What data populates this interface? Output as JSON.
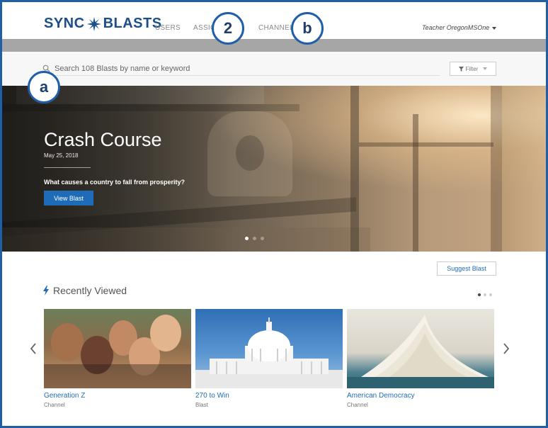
{
  "nav": {
    "logo_left": "SYNC",
    "logo_right": "BLASTS",
    "items": [
      {
        "label": "USERS"
      },
      {
        "label": "ASSIGNMENTS"
      },
      {
        "label": "CHANNELS"
      }
    ],
    "user": "Teacher OregonMSOne"
  },
  "search": {
    "placeholder": "Search 108 Blasts by name or keyword",
    "filter_label": "Filter"
  },
  "hero": {
    "title": "Crash Course",
    "date": "May 25, 2018",
    "question": "What causes a country to fall from prosperity?",
    "button_label": "View Blast",
    "slide_count": 3,
    "active_slide": 1
  },
  "content": {
    "suggest_label": "Suggest Blast",
    "section_title": "Recently Viewed",
    "cards": [
      {
        "title": "Generation Z",
        "type": "Channel"
      },
      {
        "title": "270 to Win",
        "type": "Blast"
      },
      {
        "title": "American Democracy",
        "type": "Channel"
      }
    ]
  },
  "callouts": {
    "a": "a",
    "two": "2",
    "b": "b"
  },
  "colors": {
    "brand": "#1b4f8a",
    "accent": "#1e6cb8",
    "callout_border": "#1e5fa8"
  }
}
